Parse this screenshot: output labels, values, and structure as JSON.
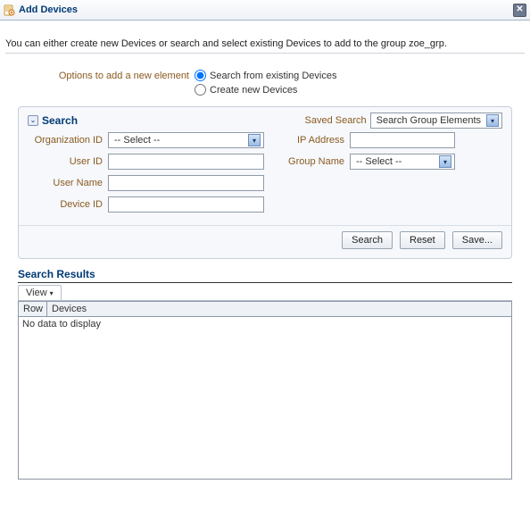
{
  "window": {
    "title": "Add Devices"
  },
  "intro": "You can either create new Devices or search and select existing Devices to add to the group zoe_grp.",
  "options": {
    "label": "Options to add a new element",
    "search_existing": "Search from existing Devices",
    "create_new": "Create new Devices",
    "selected": "search_existing"
  },
  "search": {
    "title": "Search",
    "saved_label": "Saved Search",
    "saved_value": "Search Group Elements",
    "fields": {
      "org_id": {
        "label": "Organization ID",
        "value": "-- Select --"
      },
      "user_id": {
        "label": "User ID",
        "value": ""
      },
      "user_name": {
        "label": "User Name",
        "value": ""
      },
      "device_id": {
        "label": "Device ID",
        "value": ""
      },
      "ip_address": {
        "label": "IP Address",
        "value": ""
      },
      "group_name": {
        "label": "Group Name",
        "value": "-- Select --"
      }
    },
    "buttons": {
      "search": "Search",
      "reset": "Reset",
      "save": "Save..."
    }
  },
  "results": {
    "title": "Search Results",
    "view_tab": "View",
    "columns": {
      "row": "Row",
      "devices": "Devices"
    },
    "empty": "No data to display"
  }
}
